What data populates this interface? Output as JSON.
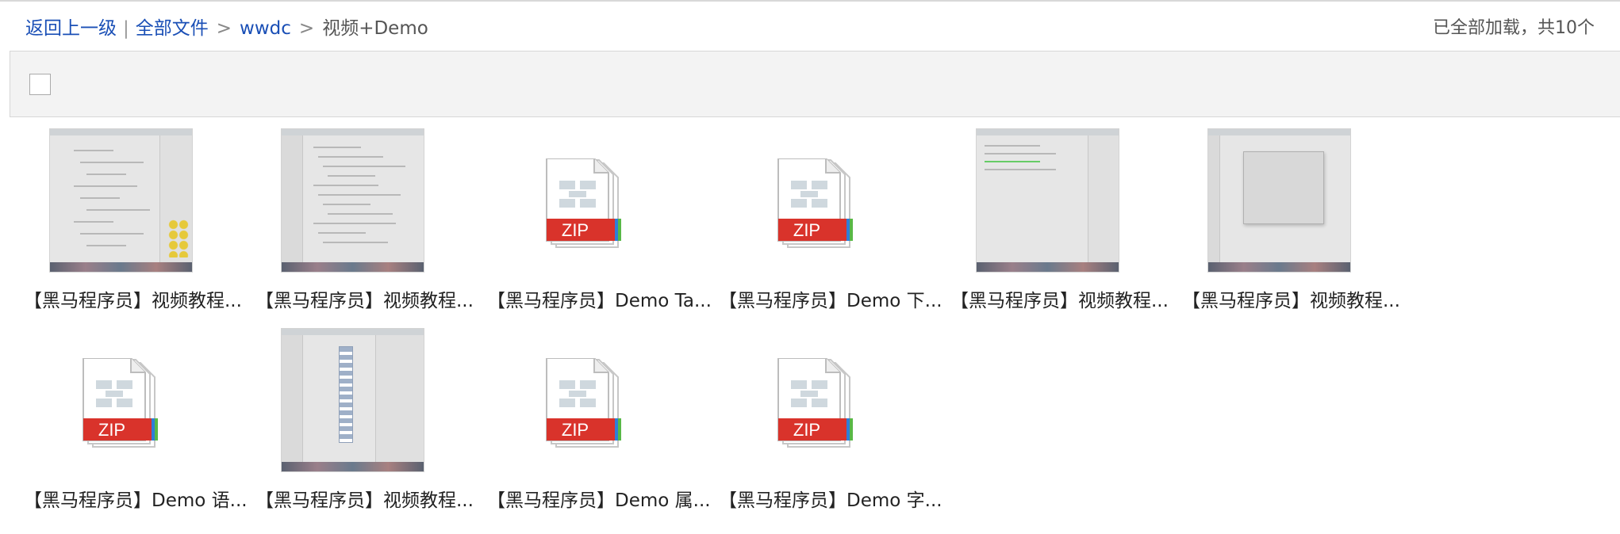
{
  "breadcrumb": {
    "back": "返回上一级",
    "pipe": "|",
    "all_files": "全部文件",
    "separator": ">",
    "folder": "wwdc",
    "current": "视频+Demo"
  },
  "load_status": "已全部加载，共10个",
  "zip_label": "ZIP",
  "files": [
    {
      "name": "【黑马程序员】视频教程...",
      "type": "video",
      "thumb": "inspector"
    },
    {
      "name": "【黑马程序员】视频教程...",
      "type": "video",
      "thumb": "code"
    },
    {
      "name": "【黑马程序员】Demo Ta...",
      "type": "zip"
    },
    {
      "name": "【黑马程序员】Demo 下...",
      "type": "zip"
    },
    {
      "name": "【黑马程序员】视频教程...",
      "type": "video",
      "thumb": "editor"
    },
    {
      "name": "【黑马程序员】视频教程...",
      "type": "video",
      "thumb": "dialog"
    },
    {
      "name": "【黑马程序员】Demo 语...",
      "type": "zip"
    },
    {
      "name": "【黑马程序员】视频教程...",
      "type": "video",
      "thumb": "columns"
    },
    {
      "name": "【黑马程序员】Demo 属...",
      "type": "zip"
    },
    {
      "name": "【黑马程序员】Demo 字...",
      "type": "zip"
    }
  ],
  "colors": {
    "link": "#1a4fb6",
    "zip_red": "#d9332b",
    "zip_blue": "#2f7ed8",
    "zip_green": "#58b847"
  }
}
